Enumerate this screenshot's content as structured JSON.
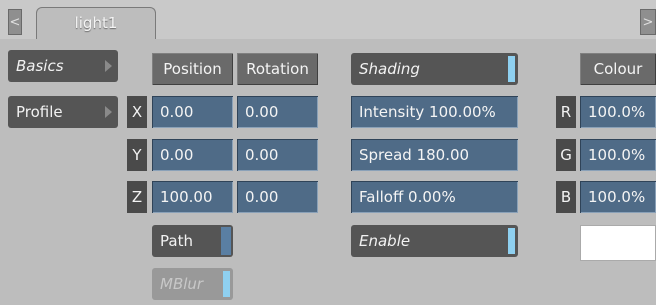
{
  "tabs": {
    "left_arrow": "<",
    "right_arrow": ">",
    "active_label": "light1"
  },
  "side": {
    "basics": "Basics",
    "profile": "Profile"
  },
  "position": {
    "header": "Position",
    "x": "0.00",
    "y": "0.00",
    "z": "100.00",
    "path_label": "Path",
    "mblur_label": "MBlur"
  },
  "rotation": {
    "header": "Rotation",
    "x": "0.00",
    "y": "0.00",
    "z": "0.00"
  },
  "axes": {
    "x": "X",
    "y": "Y",
    "z": "Z"
  },
  "shading": {
    "header": "Shading",
    "intensity": "Intensity 100.00%",
    "spread": "Spread 180.00",
    "falloff": "Falloff 0.00%",
    "enable": "Enable"
  },
  "colour": {
    "header": "Colour",
    "r_label": "R",
    "r": "100.0%",
    "g_label": "G",
    "g": "100.0%",
    "b_label": "B",
    "b": "100.0%"
  },
  "colors": {
    "panel": "#bdbdbd",
    "field": "#4f6b87",
    "button": "#555555",
    "accent": "#8fd0f0"
  }
}
